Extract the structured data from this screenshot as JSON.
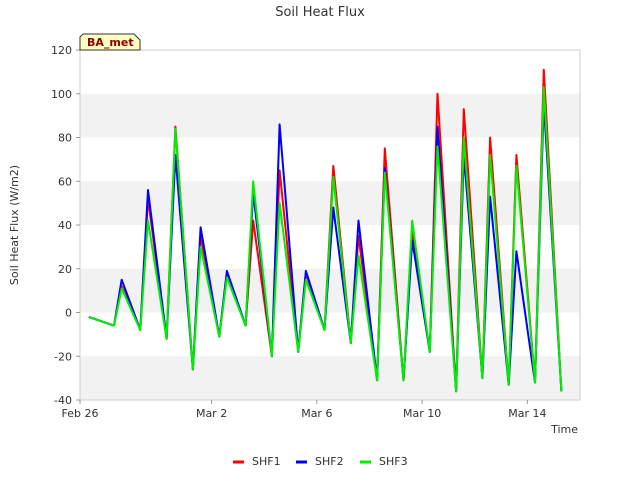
{
  "chart_data": {
    "type": "line",
    "title": "Soil Heat Flux",
    "xlabel": "Time",
    "ylabel": "Soil Heat Flux (W/m2)",
    "badge": "BA_met",
    "ylim": [
      -40,
      120
    ],
    "yticks": [
      -40,
      -20,
      0,
      20,
      40,
      60,
      80,
      100,
      120
    ],
    "xlim": [
      "2024-02-26",
      "2024-03-16"
    ],
    "xticks": [
      {
        "value": "2024-02-26",
        "label": "Feb 26"
      },
      {
        "value": "2024-03-02",
        "label": "Mar 2"
      },
      {
        "value": "2024-03-06",
        "label": "Mar 6"
      },
      {
        "value": "2024-03-10",
        "label": "Mar 10"
      },
      {
        "value": "2024-03-14",
        "label": "Mar 14"
      }
    ],
    "grid": "horizontal-bands",
    "legend_position": "bottom",
    "peaks": [
      {
        "date": "2024-02-27T14:00",
        "SHF1": 12,
        "SHF2": 15,
        "SHF3": 11
      },
      {
        "date": "2024-02-28T14:00",
        "SHF1": 52,
        "SHF2": 56,
        "SHF3": 42
      },
      {
        "date": "2024-02-29T15:00",
        "SHF1": 85,
        "SHF2": 72,
        "SHF3": 84
      },
      {
        "date": "2024-03-01T14:00",
        "SHF1": 35,
        "SHF2": 39,
        "SHF3": 30
      },
      {
        "date": "2024-03-02T14:00",
        "SHF1": 18,
        "SHF2": 19,
        "SHF3": 16
      },
      {
        "date": "2024-03-03T14:00",
        "SHF1": 42,
        "SHF2": 55,
        "SHF3": 60
      },
      {
        "date": "2024-03-04T14:00",
        "SHF1": 65,
        "SHF2": 86,
        "SHF3": 50
      },
      {
        "date": "2024-03-05T14:00",
        "SHF1": 18,
        "SHF2": 19,
        "SHF3": 15
      },
      {
        "date": "2024-03-06T15:00",
        "SHF1": 67,
        "SHF2": 48,
        "SHF3": 62
      },
      {
        "date": "2024-03-07T14:00",
        "SHF1": 35,
        "SHF2": 42,
        "SHF3": 26
      },
      {
        "date": "2024-03-08T14:00",
        "SHF1": 75,
        "SHF2": 66,
        "SHF3": 64
      },
      {
        "date": "2024-03-09T15:00",
        "SHF1": 38,
        "SHF2": 33,
        "SHF3": 42
      },
      {
        "date": "2024-03-10T14:00",
        "SHF1": 100,
        "SHF2": 85,
        "SHF3": 76
      },
      {
        "date": "2024-03-11T14:00",
        "SHF1": 93,
        "SHF2": 72,
        "SHF3": 80
      },
      {
        "date": "2024-03-12T14:00",
        "SHF1": 80,
        "SHF2": 53,
        "SHF3": 72
      },
      {
        "date": "2024-03-13T14:00",
        "SHF1": 72,
        "SHF2": 28,
        "SHF3": 67
      },
      {
        "date": "2024-03-14T15:00",
        "SHF1": 111,
        "SHF2": 96,
        "SHF3": 103
      }
    ],
    "troughs": [
      {
        "date": "2024-02-26T08:00",
        "value": -2
      },
      {
        "date": "2024-02-27T07:00",
        "value": -6
      },
      {
        "date": "2024-02-28T07:00",
        "value": -8
      },
      {
        "date": "2024-02-29T07:00",
        "value": -12
      },
      {
        "date": "2024-03-01T07:00",
        "value": -26
      },
      {
        "date": "2024-03-02T07:00",
        "value": -11
      },
      {
        "date": "2024-03-03T07:00",
        "value": -6
      },
      {
        "date": "2024-03-04T07:00",
        "value": -20
      },
      {
        "date": "2024-03-05T07:00",
        "value": -18
      },
      {
        "date": "2024-03-06T07:00",
        "value": -8
      },
      {
        "date": "2024-03-07T07:00",
        "value": -14
      },
      {
        "date": "2024-03-08T07:00",
        "value": -31
      },
      {
        "date": "2024-03-09T07:00",
        "value": -31
      },
      {
        "date": "2024-03-10T07:00",
        "value": -18
      },
      {
        "date": "2024-03-11T07:00",
        "value": -36
      },
      {
        "date": "2024-03-12T07:00",
        "value": -30
      },
      {
        "date": "2024-03-13T07:00",
        "value": -33
      },
      {
        "date": "2024-03-14T07:00",
        "value": -32
      },
      {
        "date": "2024-03-15T07:00",
        "value": -36
      }
    ],
    "series": [
      {
        "name": "SHF1",
        "color": "#ff0000"
      },
      {
        "name": "SHF2",
        "color": "#0000ff"
      },
      {
        "name": "SHF3",
        "color": "#00ee00"
      }
    ]
  }
}
